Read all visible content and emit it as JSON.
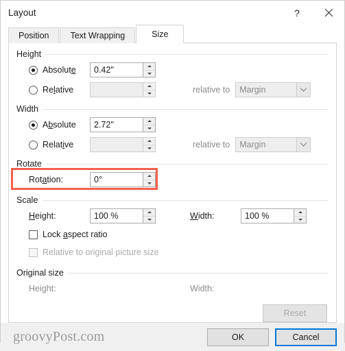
{
  "window": {
    "title": "Layout",
    "help_icon": "question-mark-icon",
    "close_icon": "close-icon"
  },
  "tabs": [
    {
      "label": "Position",
      "active": false
    },
    {
      "label": "Text Wrapping",
      "active": false
    },
    {
      "label": "Size",
      "active": true
    }
  ],
  "height_group": {
    "label": "Height",
    "absolute": {
      "label": "Absolute",
      "value": "0.42\"",
      "selected": true
    },
    "relative": {
      "label": "Relative",
      "value": "",
      "selected": false
    },
    "relative_to": {
      "label": "relative to",
      "value": "Margin",
      "enabled": false
    }
  },
  "width_group": {
    "label": "Width",
    "absolute": {
      "label": "Absolute",
      "value": "2.72\"",
      "selected": true
    },
    "relative": {
      "label": "Relative",
      "value": "",
      "selected": false
    },
    "relative_to": {
      "label": "relative to",
      "value": "Margin",
      "enabled": false
    }
  },
  "rotate_group": {
    "label": "Rotate",
    "rotation": {
      "label": "Rotation:",
      "value": "0°"
    },
    "highlight_color": "#f4604a"
  },
  "scale_group": {
    "label": "Scale",
    "height": {
      "label": "Height:",
      "value": "100 %"
    },
    "width": {
      "label": "Width:",
      "value": "100 %"
    },
    "lock_aspect_ratio": {
      "label": "Lock aspect ratio",
      "checked": false,
      "enabled": true
    },
    "relative_to_original": {
      "label": "Relative to original picture size",
      "checked": false,
      "enabled": false
    }
  },
  "original_size_group": {
    "label": "Original size",
    "height_label": "Height:",
    "height_value": "",
    "width_label": "Width:",
    "width_value": "",
    "reset_button": {
      "label": "Reset",
      "enabled": false
    }
  },
  "footer": {
    "watermark": "groovyPost.com",
    "ok_label": "OK",
    "cancel_label": "Cancel"
  }
}
